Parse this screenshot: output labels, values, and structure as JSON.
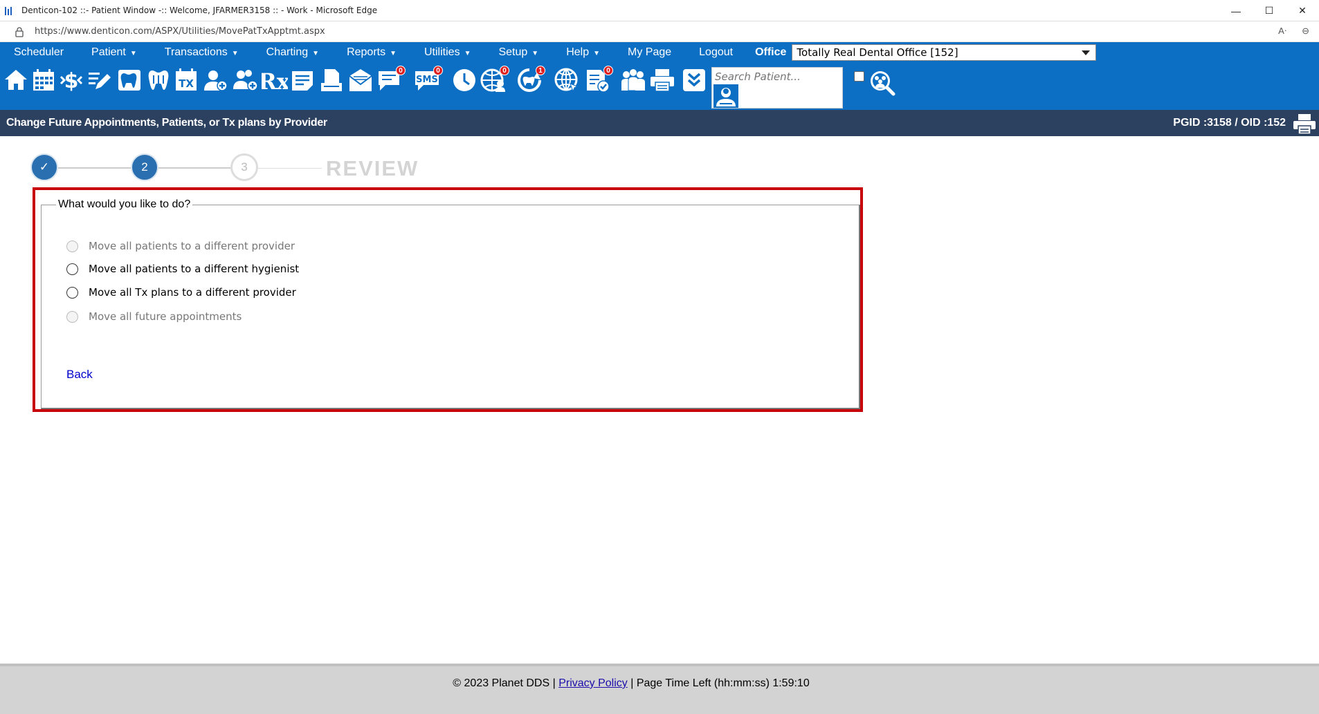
{
  "window": {
    "title": "Denticon-102 ::- Patient Window -:: Welcome, JFARMER3158 :: - Work - Microsoft Edge",
    "minimize_glyph": "—",
    "maximize_glyph": "☐",
    "close_glyph": "✕"
  },
  "address": {
    "url": "https://www.denticon.com/ASPX/Utilities/MovePatTxApptmt.aspx",
    "read_aloud_glyph": "Aᐧ",
    "zoom_glyph": "⊖"
  },
  "menu": {
    "items": [
      {
        "label": "Scheduler",
        "caret": ""
      },
      {
        "label": "Patient",
        "caret": "▼"
      },
      {
        "label": "Transactions",
        "caret": "▼"
      },
      {
        "label": "Charting",
        "caret": "▼"
      },
      {
        "label": "Reports",
        "caret": "▼"
      },
      {
        "label": "Utilities",
        "caret": "▼"
      },
      {
        "label": "Setup",
        "caret": "▼"
      },
      {
        "label": "Help",
        "caret": "▼"
      },
      {
        "label": "My Page",
        "caret": ""
      },
      {
        "label": "Logout",
        "caret": ""
      }
    ],
    "office_label": "Office",
    "office_value": "Totally Real Dental Office [152]"
  },
  "toolbar": {
    "search_placeholder": "Search Patient...",
    "sms_label": "SMS",
    "tx_label": "TX",
    "rx_label": "Rx",
    "badges": {
      "messages": "0",
      "sms": "0",
      "online": "0",
      "recall": "1",
      "forms": "0"
    },
    "colors": {
      "bar": "#0c6fc4",
      "badge": "#e02020"
    }
  },
  "page": {
    "title": "Change Future Appointments, Patients, or Tx plans by Provider",
    "ids": "PGID :3158  /  OID :152"
  },
  "steps": {
    "step1": "✓",
    "step2": "2",
    "step3": "3",
    "review": "REVIEW"
  },
  "form": {
    "legend": "What would you like to do?",
    "options": [
      {
        "label": "Move all patients to a different provider",
        "enabled": false
      },
      {
        "label": "Move all patients to a different hygienist",
        "enabled": true
      },
      {
        "label": "Move all Tx plans to a different provider",
        "enabled": true
      },
      {
        "label": "Move all future appointments",
        "enabled": false
      }
    ],
    "back_label": "Back",
    "highlight_color": "#c8000a"
  },
  "footer": {
    "copyright": "© 2023 Planet DDS",
    "sep1": " | ",
    "privacy": "Privacy Policy",
    "sep2": " |  ",
    "time_left": "Page Time Left (hh:mm:ss) 1:59:10"
  }
}
